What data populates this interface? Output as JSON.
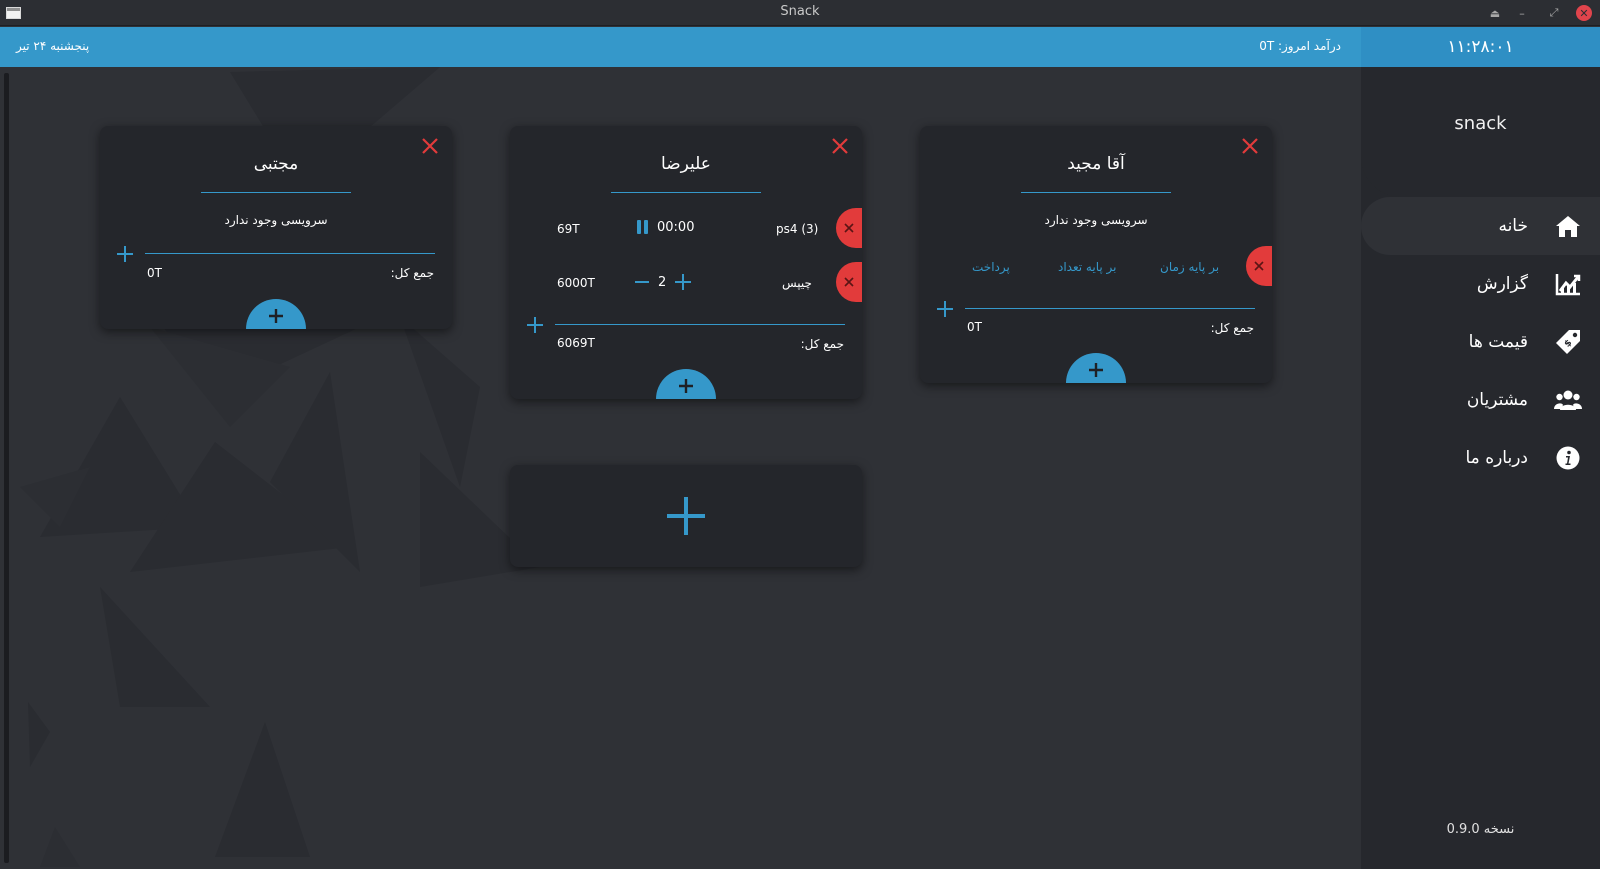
{
  "window": {
    "title": "Snack"
  },
  "topbar": {
    "date": "پنجشنبه ۲۴ تیر",
    "income": "درآمد امروز: 0T"
  },
  "sidebar": {
    "clock": "۱۱:۲۸:۰۱",
    "brand": "snack",
    "items": [
      {
        "label": "خانه",
        "icon": "home-icon"
      },
      {
        "label": "گزارش",
        "icon": "chart-icon"
      },
      {
        "label": "قیمت ها",
        "icon": "tag-icon"
      },
      {
        "label": "مشتریان",
        "icon": "users-icon"
      },
      {
        "label": "درباره ما",
        "icon": "info-icon"
      }
    ],
    "version": "نسخه 0.9.0"
  },
  "cards": [
    {
      "name": "مجتبی",
      "empty": "سرویسی وجود ندارد",
      "total_label": "جمع کل:",
      "total_value": "0T"
    },
    {
      "name": "علیرضا",
      "services": [
        {
          "name": "ps4 (3)",
          "time": "00:00",
          "price": "69T"
        },
        {
          "name": "چیپس",
          "qty": "2",
          "price": "6000T"
        }
      ],
      "total_label": "جمع کل:",
      "total_value": "6069T"
    },
    {
      "name": "آقا مجید",
      "empty": "سرویسی وجود ندارد",
      "actions": [
        "بر پایه زمان",
        "بر پایه تعداد",
        "پرداخت"
      ],
      "total_label": "جمع کل:",
      "total_value": "0T"
    }
  ],
  "colors": {
    "accent": "#3598ca",
    "danger": "#e23b3b",
    "card": "#24262b",
    "background": "#2f3136"
  }
}
